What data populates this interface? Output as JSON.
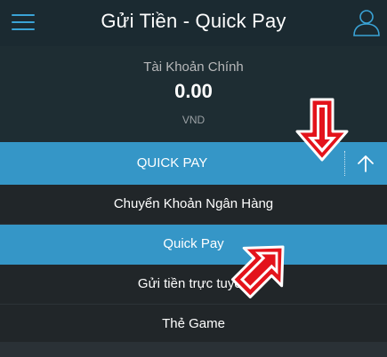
{
  "header": {
    "title": "Gửi Tiền - Quick Pay",
    "menu_icon": "hamburger-menu-icon",
    "user_icon": "user-profile-icon"
  },
  "account": {
    "label": "Tài Khoản Chính",
    "amount": "0.00",
    "currency": "VND"
  },
  "dropdown": {
    "selected": "QUICK PAY",
    "collapse_icon": "arrow-up-icon"
  },
  "menu": {
    "items": [
      {
        "label": "Chuyển Khoản Ngân Hàng",
        "active": false
      },
      {
        "label": "Quick Pay",
        "active": true
      },
      {
        "label": "Gửi tiền trực tuyến",
        "active": false
      },
      {
        "label": "Thẻ Game",
        "active": false
      }
    ]
  },
  "colors": {
    "accent": "#3596c7",
    "header_bg": "#1b2a31",
    "annotation_arrow": "#e3131b"
  }
}
